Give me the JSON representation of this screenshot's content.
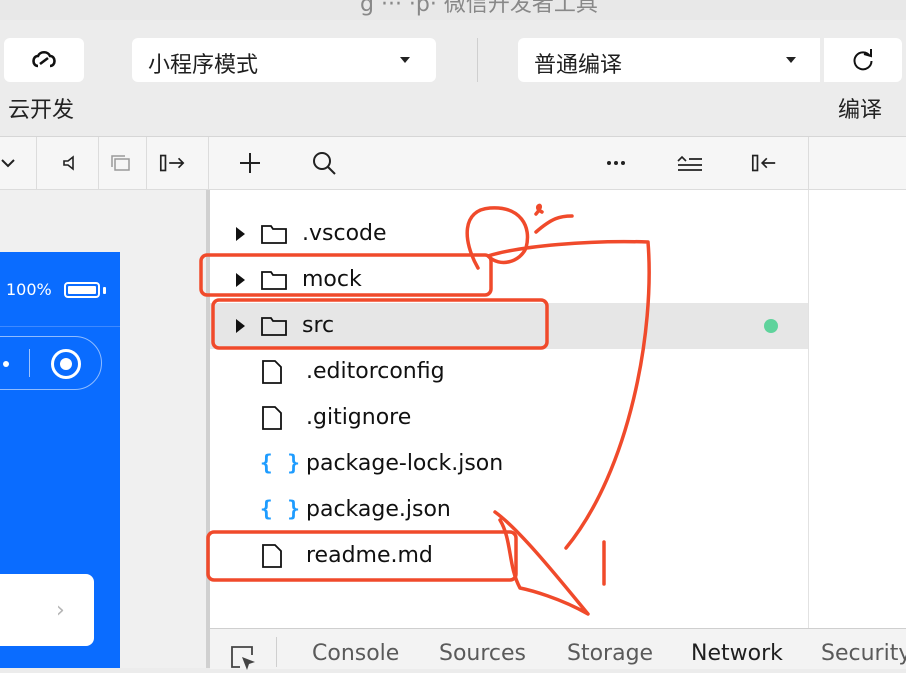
{
  "window": {
    "title": "g ··· ·p· 微信开发者工具"
  },
  "toolbar": {
    "cloud_label": "云开发",
    "mode_value": "小程序模式",
    "compile_value": "普通编译",
    "compile_label": "编译"
  },
  "simulator": {
    "battery_percent": "100%",
    "accent": "#0a6cff"
  },
  "explorer": {
    "items": [
      {
        "name": ".vscode",
        "type": "folder"
      },
      {
        "name": "mock",
        "type": "folder"
      },
      {
        "name": "src",
        "type": "folder",
        "selected": true,
        "status": "modified"
      },
      {
        "name": ".editorconfig",
        "type": "file"
      },
      {
        "name": ".gitignore",
        "type": "file"
      },
      {
        "name": "package-lock.json",
        "type": "json",
        "icon_text": "{ }"
      },
      {
        "name": "package.json",
        "type": "json",
        "icon_text": "{ }"
      },
      {
        "name": "readme.md",
        "type": "file"
      }
    ],
    "status_color": "#5fd39c"
  },
  "devtools": {
    "tabs": [
      "Console",
      "Sources",
      "Storage",
      "Network",
      "Security"
    ],
    "active_tab": "Network"
  },
  "annotation": {
    "color": "#f04a2b"
  }
}
